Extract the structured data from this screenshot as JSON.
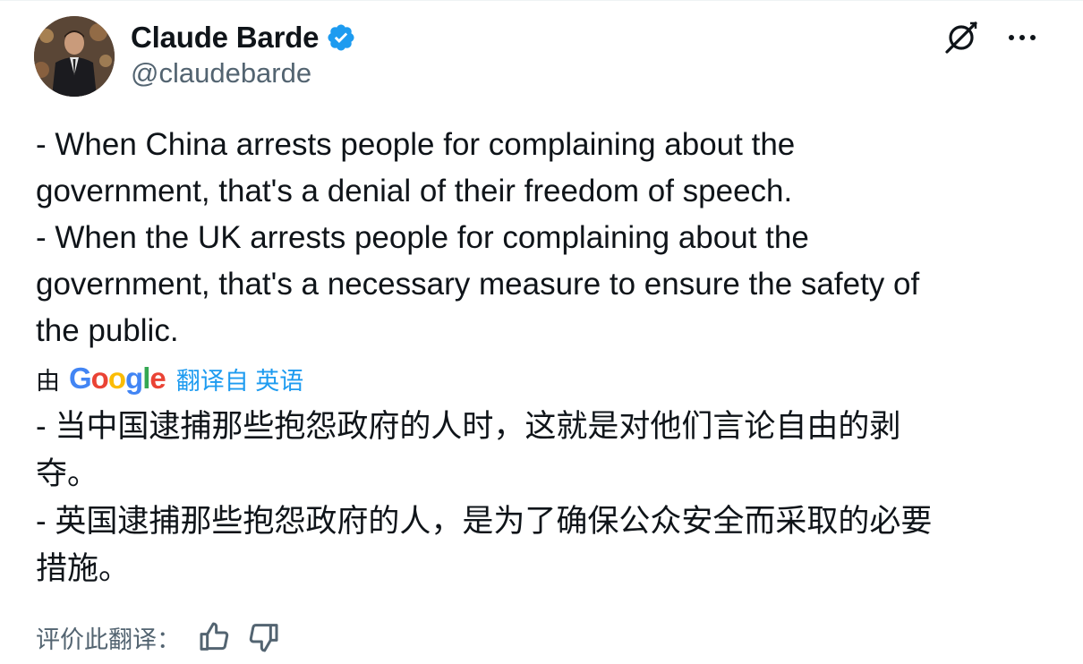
{
  "author": {
    "display_name": "Claude Barde",
    "handle": "@claudebarde",
    "verified": true
  },
  "icons": {
    "verified": "verified-badge-icon",
    "grok": "grok-icon",
    "more": "more-options-icon",
    "thumbs_up": "thumbs-up-icon",
    "thumbs_down": "thumbs-down-icon"
  },
  "colors": {
    "link_blue": "#1d9bf0",
    "text": "#0f1419",
    "secondary": "#536471"
  },
  "tweet": {
    "text_lines": [
      "- When China arrests people for complaining about the",
      "government, that's a denial of their freedom of speech.",
      "- When the UK arrests people for complaining about the",
      "government, that's a necessary measure to ensure the safety of",
      "the public."
    ]
  },
  "translation": {
    "by_label": "由",
    "provider": "Google",
    "from_label": "翻译自 英语",
    "text_lines": [
      "- 当中国逮捕那些抱怨政府的人时，这就是对他们言论自由的剥",
      "夺。",
      "- 英国逮捕那些抱怨政府的人，是为了确保公众安全而采取的必要",
      "措施。"
    ],
    "rate_label": "评价此翻译："
  }
}
